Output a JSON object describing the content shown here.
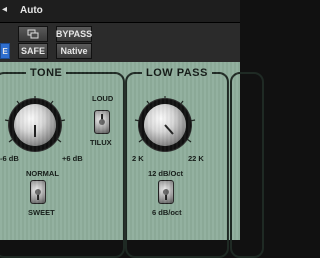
{
  "topbar": {
    "auto_label": "Auto",
    "safe_label": "SAFE",
    "bypass_label": "BYPASS",
    "native_label": "Native"
  },
  "tone": {
    "title": "TONE",
    "min_label": "-6 dB",
    "max_label": "+6 dB",
    "loud_label": "LOUD",
    "tilux_label": "TILUX",
    "normal_label": "NORMAL",
    "sweet_label": "SWEET"
  },
  "lowpass": {
    "title": "LOW PASS",
    "min_label": "2 K",
    "max_label": "22 K",
    "slope_high_label": "12 dB/Oct",
    "slope_low_label": "6 dB/oct"
  },
  "colors": {
    "panel": "#8fae9c",
    "frame": "#1f2a24",
    "accent_blue": "#2f6fd0"
  }
}
